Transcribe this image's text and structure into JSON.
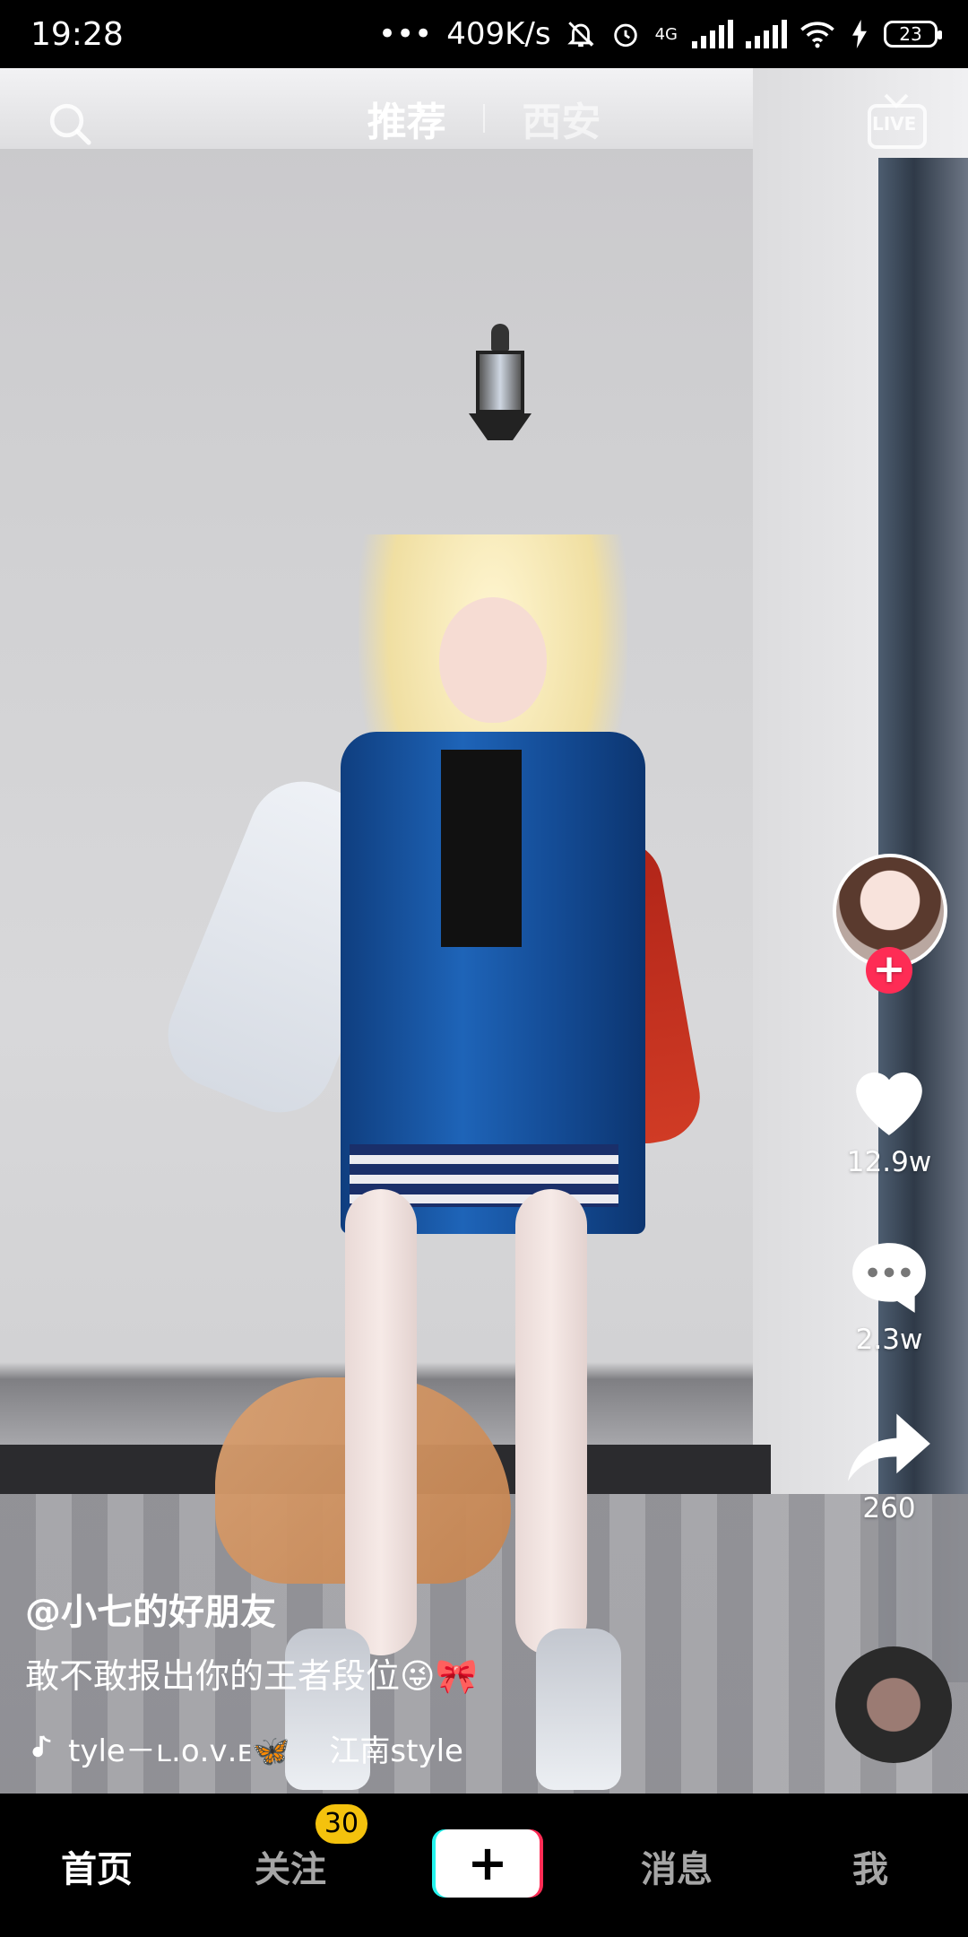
{
  "status_bar": {
    "time": "19:28",
    "net_speed": "409K/s",
    "network_type": "4G",
    "battery": "23",
    "icons": [
      "mute-icon",
      "alarm-icon",
      "signal-icon",
      "wifi-icon",
      "charging-icon"
    ]
  },
  "top_nav": {
    "tabs": [
      {
        "label": "推荐",
        "active": true
      },
      {
        "label": "西安",
        "active": false
      }
    ],
    "live_label": "LIVE"
  },
  "side_actions": {
    "likes": "12.9w",
    "comments": "2.3w",
    "shares": "260"
  },
  "caption": {
    "username": "@小七的好朋友",
    "text": "敢不敢报出你的王者段位😜🎀",
    "music": "tyle－ʟ.ᴏ.ᴠ.ᴇ🦋",
    "music_title": "江南style"
  },
  "bottom_nav": {
    "items": [
      {
        "label": "首页",
        "active": true
      },
      {
        "label": "关注",
        "active": false
      },
      {
        "label": "消息",
        "active": false
      },
      {
        "label": "我",
        "active": false
      }
    ],
    "follow_badge": "30",
    "create_label": "+"
  },
  "colors": {
    "accent_red": "#fe2c55",
    "accent_cyan": "#25f4ee",
    "badge_yellow": "#f4c20d"
  }
}
